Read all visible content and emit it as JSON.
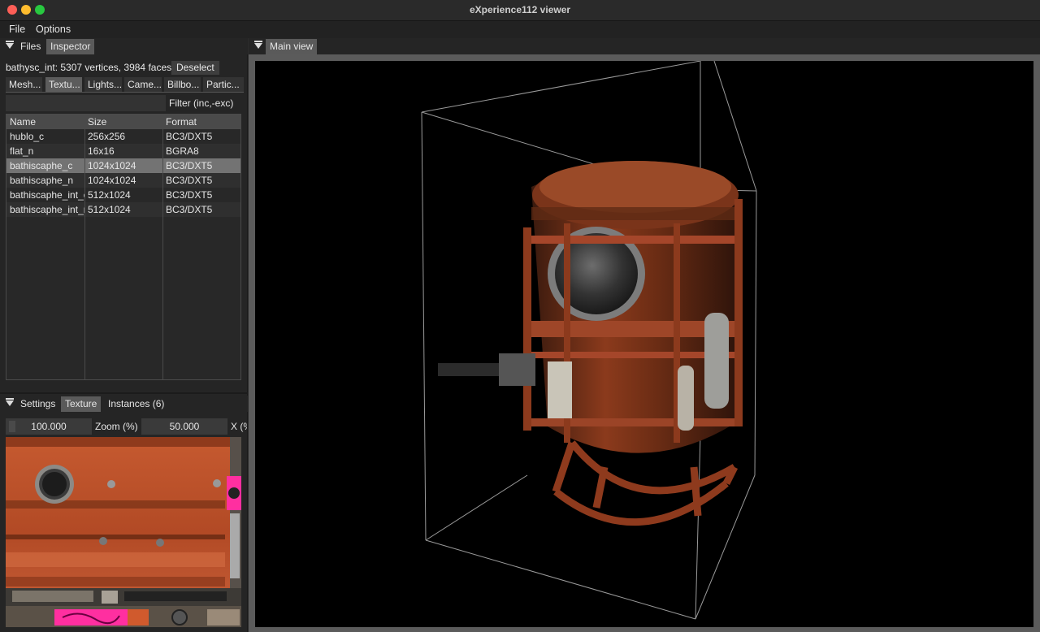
{
  "window": {
    "title": "eXperience112 viewer"
  },
  "menu": {
    "items": [
      "File",
      "Options"
    ]
  },
  "left_tabs": [
    "Files",
    "Inspector"
  ],
  "inspector": {
    "info": "bathysc_int: 5307 vertices, 3984 faces",
    "deselect_label": "Deselect",
    "subtabs": [
      "Mesh...",
      "Textu...",
      "Lights...",
      "Came...",
      "Billbo...",
      "Partic..."
    ],
    "filter_label": "Filter (inc,-exc)",
    "filter_value": ""
  },
  "texture_table": {
    "columns": [
      "Name",
      "Size",
      "Format"
    ],
    "rows": [
      {
        "name": "hublo_c",
        "size": "256x256",
        "format": "BC3/DXT5"
      },
      {
        "name": "flat_n",
        "size": "16x16",
        "format": "BGRA8"
      },
      {
        "name": "bathiscaphe_c",
        "size": "1024x1024",
        "format": "BC3/DXT5"
      },
      {
        "name": "bathiscaphe_n",
        "size": "1024x1024",
        "format": "BC3/DXT5"
      },
      {
        "name": "bathiscaphe_int_c",
        "size": "512x1024",
        "format": "BC3/DXT5"
      },
      {
        "name": "bathiscaphe_int_n",
        "size": "512x1024",
        "format": "BC3/DXT5"
      }
    ],
    "selected_row": 2
  },
  "bottom_tabs": [
    "Settings",
    "Texture",
    "Instances (6)"
  ],
  "texture_view": {
    "zoom_value": "100.000",
    "zoom_label": "Zoom (%)",
    "x_value": "50.000",
    "x_label": "X (%)"
  },
  "main_view": {
    "tab_label": "Main view"
  },
  "colors": {
    "accent_rust": "#b8532d",
    "selection": "#737373",
    "tab_active": "#5a5a5a",
    "magenta": "#ff2fa0"
  }
}
